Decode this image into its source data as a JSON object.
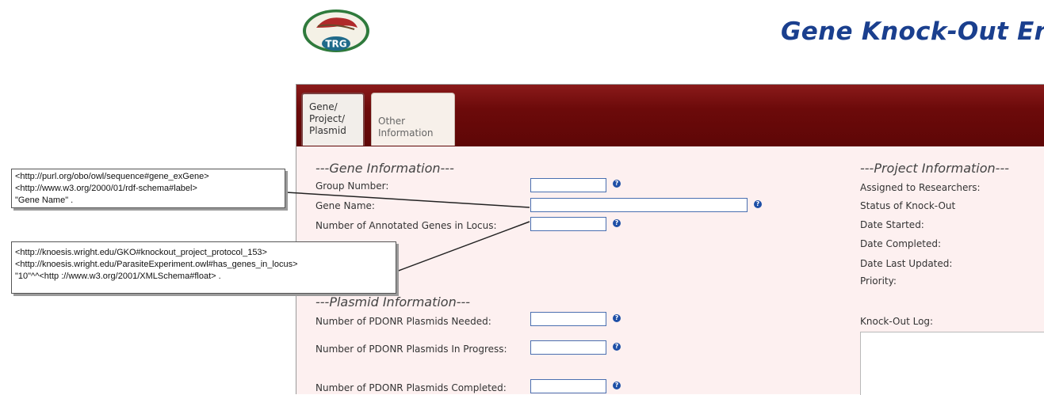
{
  "header": {
    "logo_text": "TRG",
    "title": "Gene Knock-Out En"
  },
  "tabs": [
    {
      "label_lines": [
        "Gene/",
        "Project/",
        "Plasmid"
      ],
      "active": true
    },
    {
      "label_lines": [
        "Other",
        "Information"
      ],
      "active": false
    }
  ],
  "gene_section": {
    "title": "---Gene Information---",
    "fields": [
      {
        "label": "Group Number:",
        "value": ""
      },
      {
        "label": "Gene Name:",
        "value": ""
      },
      {
        "label": "Number of Annotated Genes in Locus:",
        "value": ""
      }
    ]
  },
  "plasmid_section": {
    "title": "---Plasmid Information---",
    "fields": [
      {
        "label": "Number of PDONR Plasmids Needed:",
        "value": ""
      },
      {
        "label": "Number of PDONR Plasmids In Progress:",
        "value": ""
      },
      {
        "label": "Number of PDONR Plasmids Completed:",
        "value": ""
      }
    ]
  },
  "project_section": {
    "title": "---Project Information---",
    "labels": [
      "Assigned to Researchers:",
      "Status of Knock-Out",
      "Date Started:",
      "Date Completed:",
      "Date Last Updated:",
      "Priority:"
    ],
    "log_label": "Knock-Out Log:"
  },
  "help_glyph": "?",
  "callouts": [
    {
      "lines": [
        "<http://purl.org/obo/owl/sequence#gene_exGene>",
        "<http://www.w3.org/2000/01/rdf-schema#label>",
        "\"Gene Name\" ."
      ]
    },
    {
      "lines": [
        "<http://knoesis.wright.edu/GKO#knockout_project_protocol_153>",
        "<http://knoesis.wright.edu/ParasiteExperiment.owl#has_genes_in_locus>",
        "\"10\"^^<http ://www.w3.org/2001/XMLSchema#float> ."
      ]
    }
  ],
  "colors": {
    "title_blue": "#1a3f8e",
    "tabbar_maroon": "#6c0a0a",
    "panel_bg": "#fdf0f0",
    "help_icon_blue": "#1e4fa6",
    "input_border": "#4a6fb0"
  }
}
